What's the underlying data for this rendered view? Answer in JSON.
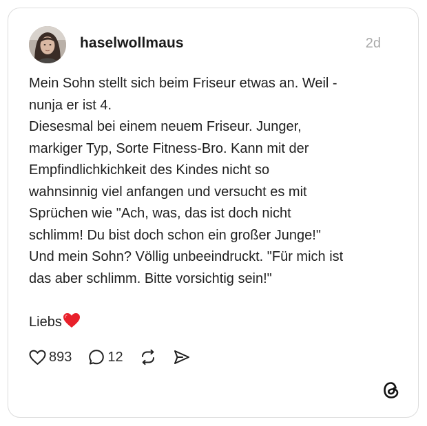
{
  "post": {
    "username": "haselwollmaus",
    "timestamp": "2d",
    "lines": [
      "Mein Sohn stellt sich beim Friseur etwas an. Weil -",
      "nunja er ist 4.",
      "Diesesmal bei einem neuem Friseur. Junger,",
      "markiger Typ, Sorte Fitness-Bro. Kann mit der",
      "Empfindlichkichkeit des Kindes nicht so",
      "wahnsinnig viel anfangen und versucht es mit",
      "Sprüchen wie \"Ach, was, das ist doch nicht",
      "schlimm! Du bist doch schon ein großer Junge!\"",
      "Und mein Sohn? Völlig unbeeindruckt. \"Für mich ist",
      "das aber schlimm. Bitte vorsichtig sein!\""
    ],
    "closing": "Liebs",
    "closing_emoji": "red-heart-emoji"
  },
  "actions": {
    "likes": "893",
    "replies": "12",
    "like_icon": "heart-icon",
    "reply_icon": "comment-icon",
    "repost_icon": "repost-icon",
    "share_icon": "send-icon"
  },
  "branding": {
    "logo_icon": "threads-logo-icon"
  },
  "colors": {
    "border": "#dcdcdc",
    "text": "#1f1f1f",
    "muted": "#a8a8a8",
    "heart": "#e8202a"
  }
}
